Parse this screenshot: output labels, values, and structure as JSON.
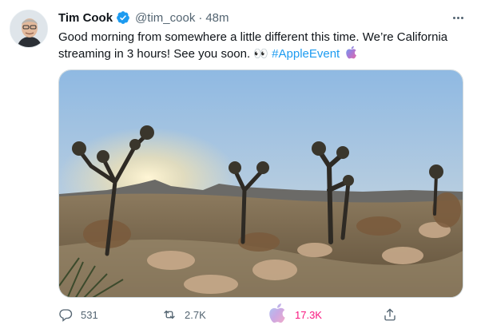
{
  "author": {
    "name": "Tim Cook",
    "handle": "@tim_cook",
    "separator": "·",
    "time": "48m",
    "verified": true
  },
  "tweet": {
    "text": "Good morning from somewhere a little different this time. We’re California streaming in 3 hours! See you soon. 👀",
    "hashtag": "#AppleEvent"
  },
  "actions": {
    "reply_count": "531",
    "retweet_count": "2.7K",
    "like_count": "17.3K"
  },
  "icons": {
    "more": "more-horizontal-icon",
    "reply": "reply-icon",
    "retweet": "retweet-icon",
    "like": "apple-like-icon",
    "share": "share-icon",
    "verified": "verified-badge-icon",
    "hashflag": "apple-hashflag-icon"
  },
  "colors": {
    "accent": "#1d9bf0",
    "like": "#f91880",
    "muted": "#536471"
  }
}
